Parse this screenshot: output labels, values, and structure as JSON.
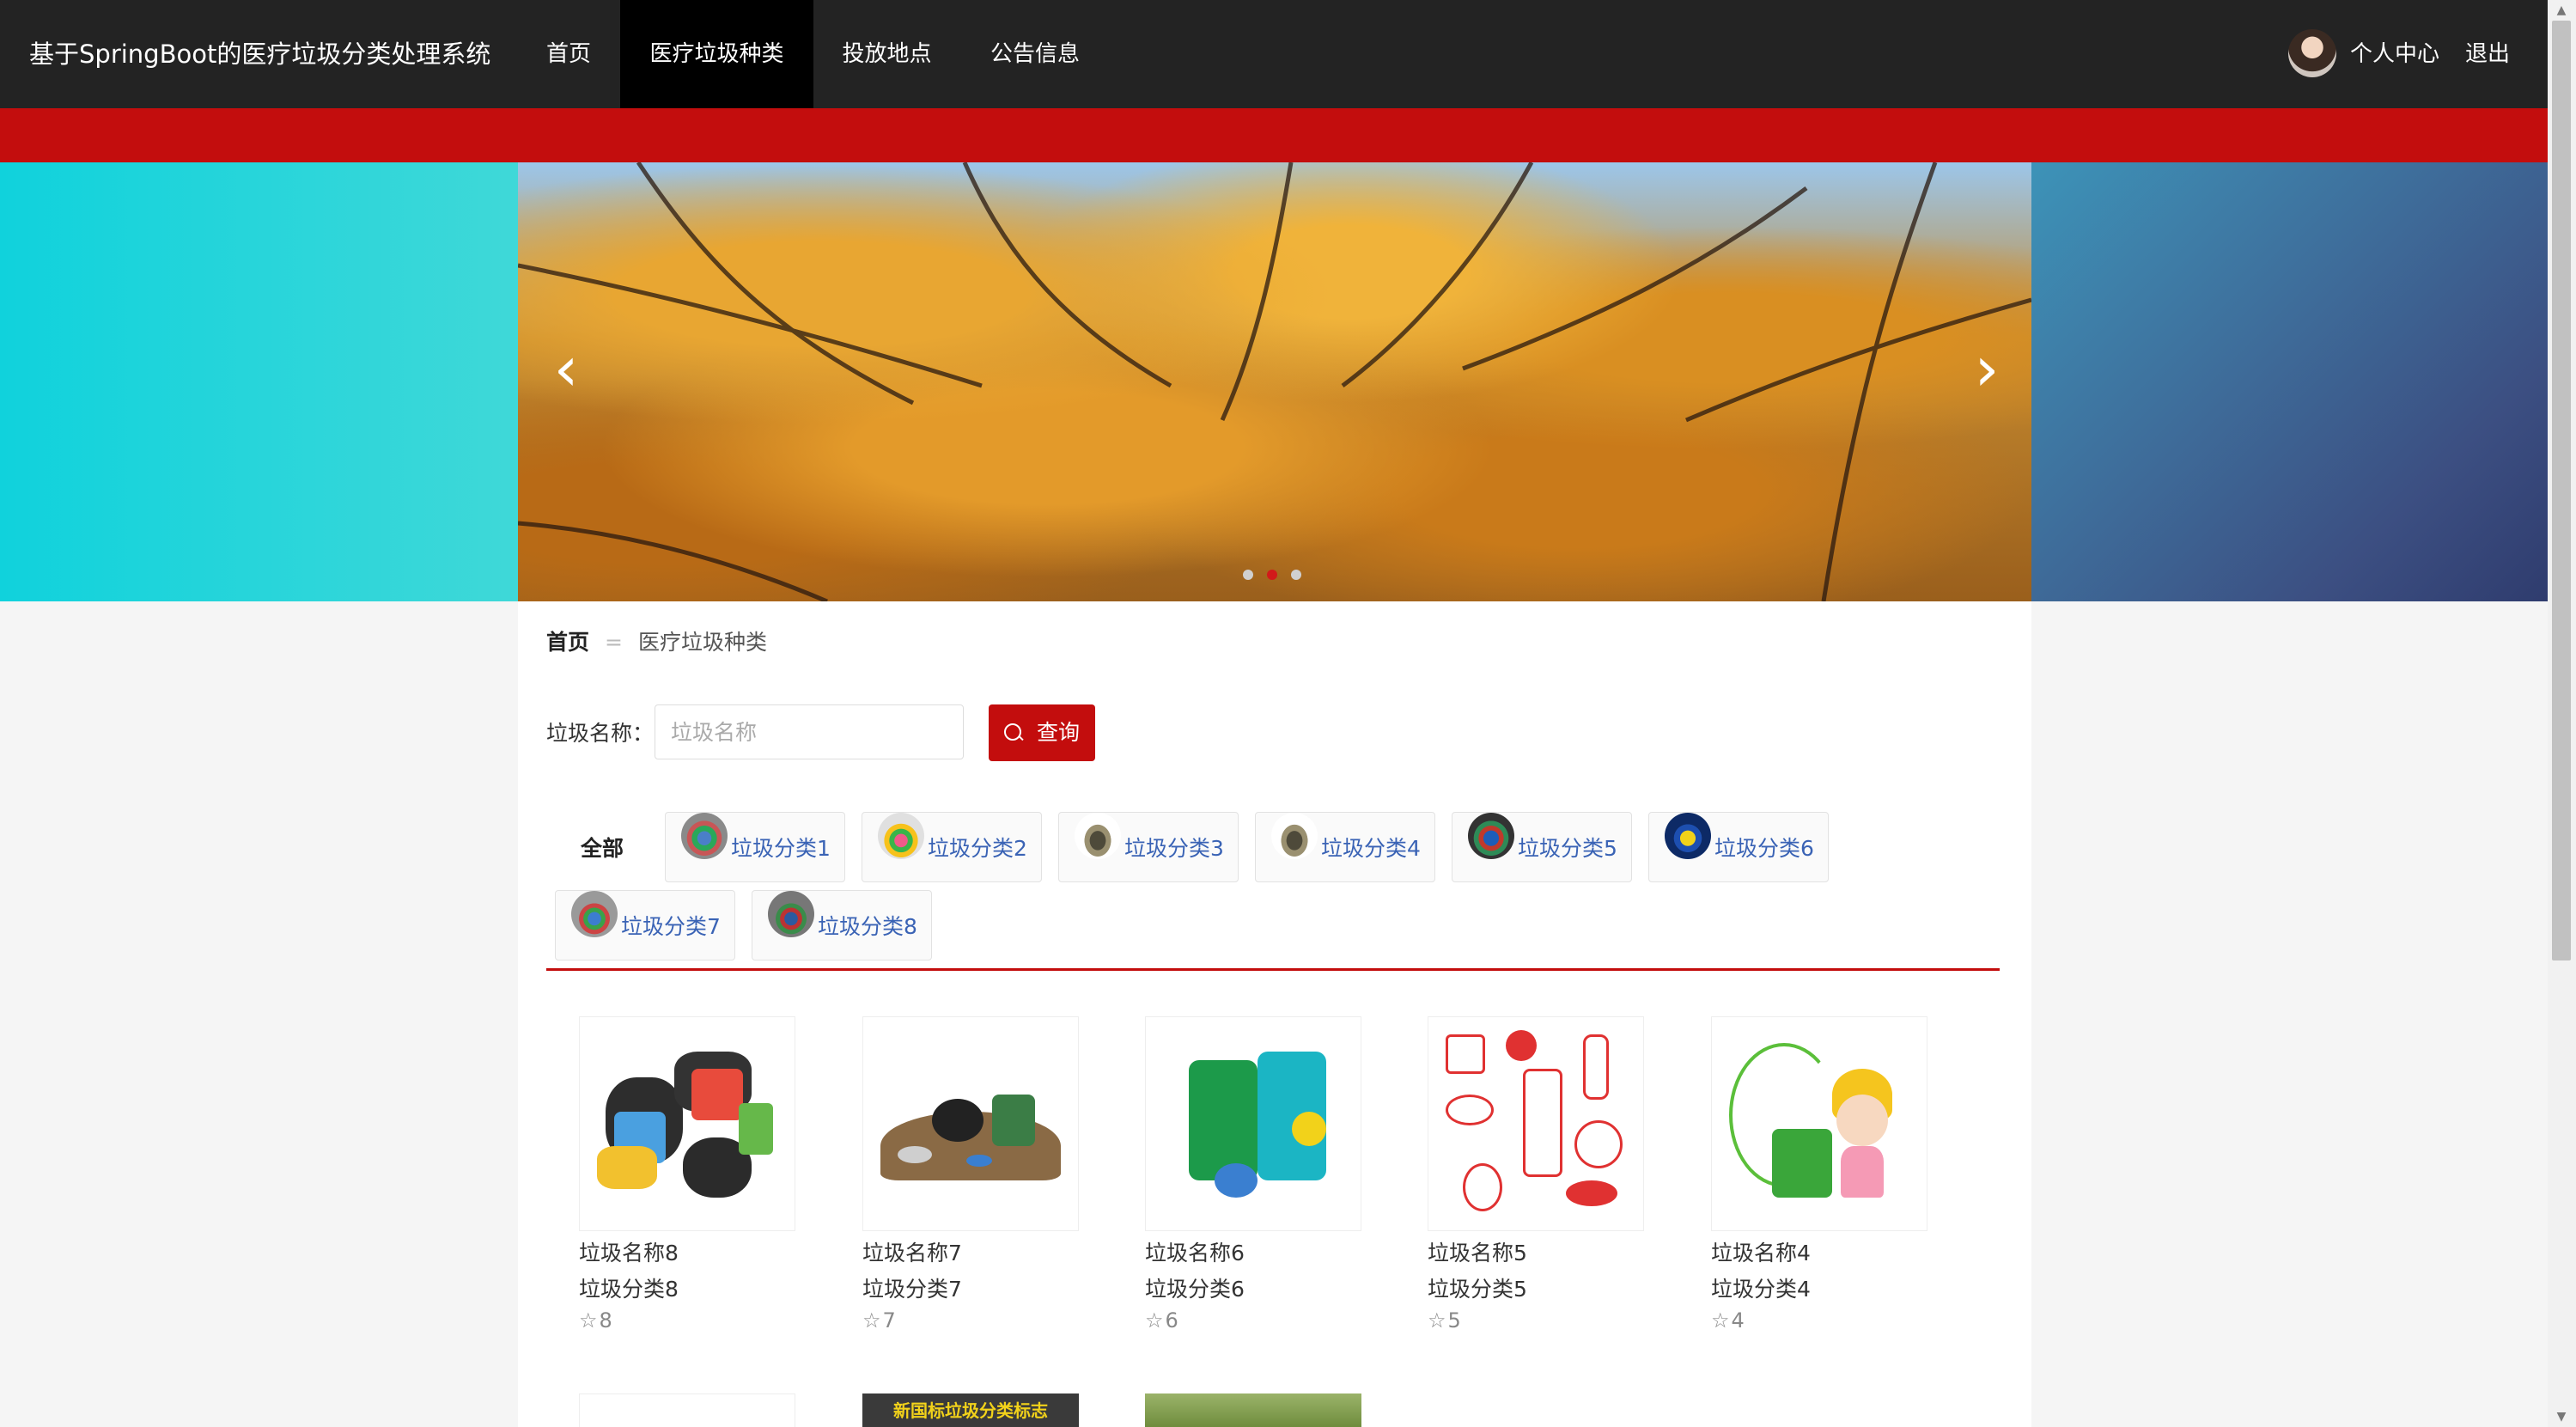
{
  "nav": {
    "brand": "基于SpringBoot的医疗垃圾分类处理系统",
    "links": [
      "首页",
      "医疗垃圾种类",
      "投放地点",
      "公告信息"
    ],
    "active_index": 1,
    "profile": "个人中心",
    "logout": "退出"
  },
  "banner": {
    "prev_icon": "chevron-left-icon",
    "next_icon": "chevron-right-icon",
    "dot_count": 3,
    "active_dot": 1
  },
  "breadcrumb": {
    "home": "首页",
    "separator": "=",
    "current": "医疗垃圾种类"
  },
  "search": {
    "label": "垃圾名称：",
    "placeholder": "垃圾名称",
    "value": "",
    "button": "查询",
    "button_icon": "search-icon"
  },
  "categories": {
    "all_label": "全部",
    "items": [
      "垃圾分类1",
      "垃圾分类2",
      "垃圾分类3",
      "垃圾分类4",
      "垃圾分类5",
      "垃圾分类6",
      "垃圾分类7",
      "垃圾分类8"
    ]
  },
  "products": [
    {
      "name": "垃圾名称8",
      "type": "垃圾分类8",
      "stars": "8",
      "image": "mixed-garbage-pile"
    },
    {
      "name": "垃圾名称7",
      "type": "垃圾分类7",
      "stars": "7",
      "image": "garbage-heap"
    },
    {
      "name": "垃圾名称6",
      "type": "垃圾分类6",
      "stars": "6",
      "image": "sorting-poster"
    },
    {
      "name": "垃圾名称5",
      "type": "垃圾分类5",
      "stars": "5",
      "image": "hazardous-waste"
    },
    {
      "name": "垃圾名称4",
      "type": "垃圾分类4",
      "stars": "4",
      "image": "cartoon-girl-bin"
    }
  ],
  "more_products": [
    {
      "caption": "新国标垃圾分类标志"
    },
    {
      "caption": ""
    },
    {
      "caption": ""
    }
  ],
  "colors": {
    "primary": "#c30d0d",
    "nav_bg": "#232323",
    "link": "#3a63b5"
  }
}
